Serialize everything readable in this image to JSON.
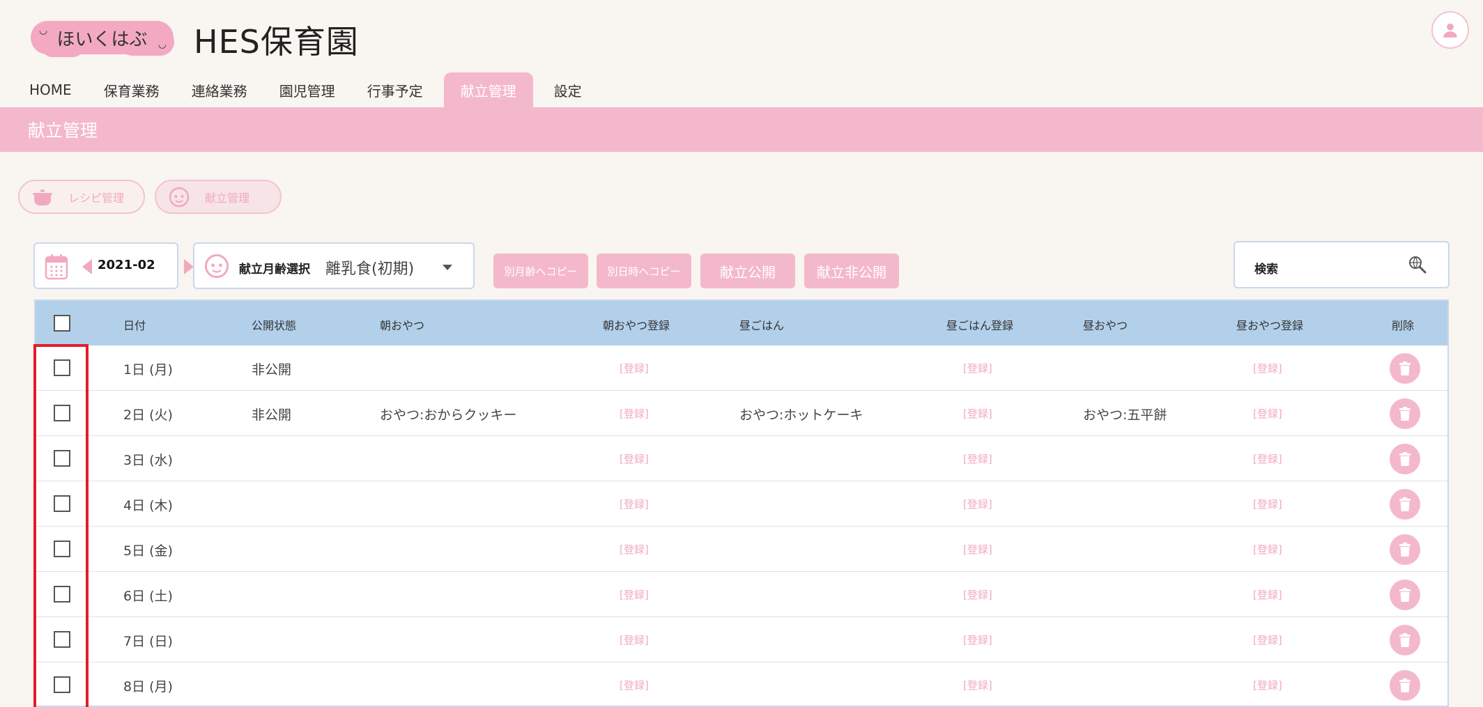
{
  "header": {
    "logo_text": "ほいくはぶ",
    "app_title": "HES保育園"
  },
  "nav": {
    "tabs": [
      {
        "label": "HOME",
        "active": false
      },
      {
        "label": "保育業務",
        "active": false
      },
      {
        "label": "連絡業務",
        "active": false
      },
      {
        "label": "園児管理",
        "active": false
      },
      {
        "label": "行事予定",
        "active": false
      },
      {
        "label": "献立管理",
        "active": true
      },
      {
        "label": "設定",
        "active": false
      }
    ]
  },
  "banner": {
    "title": "献立管理"
  },
  "subnav": {
    "recipe_label": "レシピ管理",
    "menu_label": "献立管理"
  },
  "toolbar": {
    "month": "2021-02",
    "age_label": "献立月齢選択",
    "age_value": "離乳食(初期)",
    "copy_age_label": "別月齢へコピー",
    "copy_date_label": "別日時へコピー",
    "publish_label": "献立公開",
    "unpublish_label": "献立非公開",
    "search_placeholder": "検索"
  },
  "table": {
    "headers": {
      "date": "日付",
      "status": "公開状態",
      "morning_snack": "朝おやつ",
      "morning_snack_reg": "朝おやつ登録",
      "lunch": "昼ごはん",
      "lunch_reg": "昼ごはん登録",
      "afternoon_snack": "昼おやつ",
      "afternoon_snack_reg": "昼おやつ登録",
      "delete": "削除"
    },
    "register_label": "[登録]",
    "rows": [
      {
        "date": "1日 (月)",
        "status": "非公開",
        "morning_snack": "",
        "lunch": "",
        "afternoon_snack": ""
      },
      {
        "date": "2日 (火)",
        "status": "非公開",
        "morning_snack": "おやつ:おからクッキー",
        "lunch": "おやつ:ホットケーキ",
        "afternoon_snack": "おやつ:五平餅"
      },
      {
        "date": "3日 (水)",
        "status": "",
        "morning_snack": "",
        "lunch": "",
        "afternoon_snack": ""
      },
      {
        "date": "4日 (木)",
        "status": "",
        "morning_snack": "",
        "lunch": "",
        "afternoon_snack": ""
      },
      {
        "date": "5日 (金)",
        "status": "",
        "morning_snack": "",
        "lunch": "",
        "afternoon_snack": ""
      },
      {
        "date": "6日 (土)",
        "status": "",
        "morning_snack": "",
        "lunch": "",
        "afternoon_snack": ""
      },
      {
        "date": "7日 (日)",
        "status": "",
        "morning_snack": "",
        "lunch": "",
        "afternoon_snack": ""
      },
      {
        "date": "8日 (月)",
        "status": "",
        "morning_snack": "",
        "lunch": "",
        "afternoon_snack": ""
      }
    ]
  },
  "colors": {
    "accent_pink": "#f4b8cc",
    "header_blue": "#b2d0ea",
    "highlight_red": "#e21c2a"
  }
}
